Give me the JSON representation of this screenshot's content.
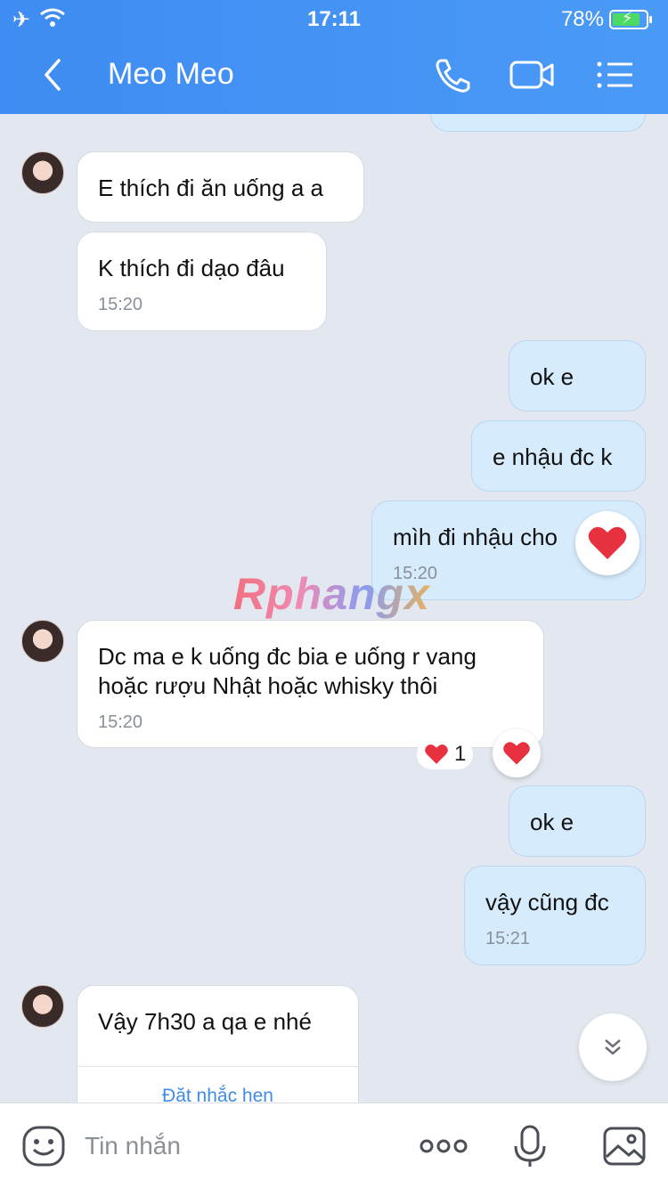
{
  "status": {
    "time": "17:11",
    "battery": "78%",
    "airplane_icon": "airplane-icon",
    "wifi_icon": "wifi-icon"
  },
  "header": {
    "title": "Meo Meo",
    "back_icon": "chevron-left-icon",
    "call_icon": "phone-icon",
    "video_icon": "video-icon",
    "menu_icon": "menu-list-icon"
  },
  "messages": [
    {
      "side": "in",
      "text": "E thích đi ăn uống a a"
    },
    {
      "side": "in",
      "text": "K thích đi dạo đâu",
      "time": "15:20"
    },
    {
      "side": "out",
      "text": "ok e"
    },
    {
      "side": "out",
      "text": "e nhậu đc k"
    },
    {
      "side": "out",
      "text": "mìh đi nhậu cho",
      "time": "15:20",
      "reaction": "heart"
    },
    {
      "side": "in",
      "text": "Dc ma e k uống đc bia e uống r vang hoặc rượu Nhật hoặc whisky thôi",
      "time": "15:20",
      "reaction_count": "1"
    },
    {
      "side": "out",
      "text": "ok e"
    },
    {
      "side": "out",
      "text": "vậy cũng đc",
      "time": "15:21"
    },
    {
      "side": "in",
      "text": "Vậy 7h30 a qa e nhé",
      "action": "Đặt nhắc hẹn"
    }
  ],
  "watermark": "Rphangx",
  "input": {
    "placeholder": "Tin nhắn",
    "emoji_icon": "sticker-icon",
    "more_icon": "more-dots-icon",
    "mic_icon": "microphone-icon",
    "image_icon": "image-icon"
  },
  "colors": {
    "header": "#4a9af7",
    "bubble_out": "#d6ecfd",
    "bubble_in": "#ffffff",
    "background": "#e3e7ef",
    "link": "#3f8ce8"
  }
}
